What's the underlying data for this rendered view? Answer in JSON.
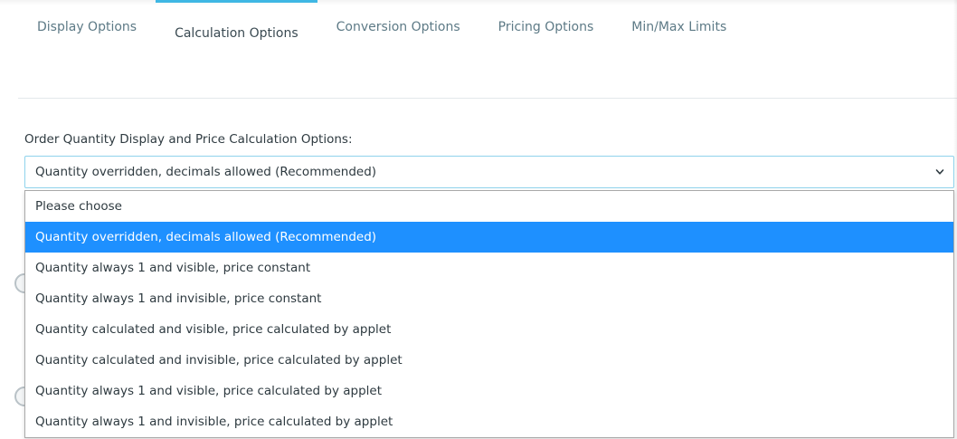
{
  "tabs": [
    {
      "label": "Display Options",
      "active": false
    },
    {
      "label": "Calculation Options",
      "active": true
    },
    {
      "label": "Conversion Options",
      "active": false
    },
    {
      "label": "Pricing Options",
      "active": false
    },
    {
      "label": "Min/Max Limits",
      "active": false
    }
  ],
  "form": {
    "field_label": "Order Quantity Display and Price Calculation Options:",
    "selected_value": "Quantity overridden, decimals allowed (Recommended)",
    "options": [
      "Please choose",
      "Quantity overridden, decimals allowed (Recommended)",
      "Quantity always 1 and visible, price constant",
      "Quantity always 1 and invisible, price constant",
      "Quantity calculated and visible, price calculated by applet",
      "Quantity calculated and invisible, price calculated by applet",
      "Quantity always 1 and visible, price calculated by applet",
      "Quantity always 1 and invisible, price calculated by applet"
    ],
    "selected_index": 1
  },
  "icons": {
    "select_chevron": "chevron-down-icon"
  },
  "colors": {
    "accent": "#3fb7e4",
    "tab_text": "#5d7a86",
    "selected_option_bg": "#1e90ff",
    "select_border": "#8fd3ec"
  }
}
